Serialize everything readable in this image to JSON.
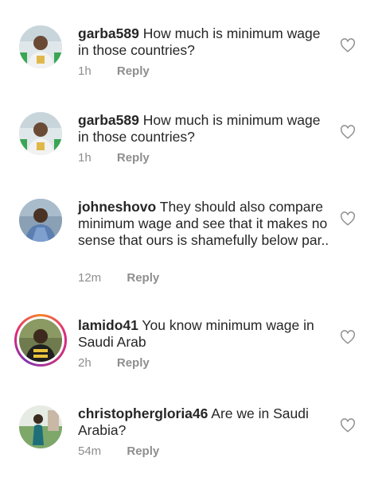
{
  "comments": [
    {
      "username": "garba589",
      "text": "How much is minimum wage in those countries?",
      "time": "1h",
      "reply_label": "Reply",
      "avatar_has_story": false,
      "liked": false
    },
    {
      "username": "garba589",
      "text": "How much is minimum wage in those countries?",
      "time": "1h",
      "reply_label": "Reply",
      "avatar_has_story": false,
      "liked": false
    },
    {
      "username": "johneshovo",
      "text": "They should also compare minimum wage and see that it makes no sense that ours is shamefully below par..",
      "time": "12m",
      "reply_label": "Reply",
      "avatar_has_story": false,
      "liked": false
    },
    {
      "username": "lamido41",
      "text": "You know minimum wage in Saudi Arab",
      "time": "2h",
      "reply_label": "Reply",
      "avatar_has_story": true,
      "liked": false
    },
    {
      "username": "christophergloria46",
      "text": "Are we in Saudi Arabia?",
      "time": "54m",
      "reply_label": "Reply",
      "avatar_has_story": false,
      "liked": false
    }
  ],
  "icons": {
    "like": "heart-outline-icon"
  },
  "colors": {
    "text": "#262626",
    "meta": "#8e8e8e",
    "icon": "#8e8e8e"
  }
}
